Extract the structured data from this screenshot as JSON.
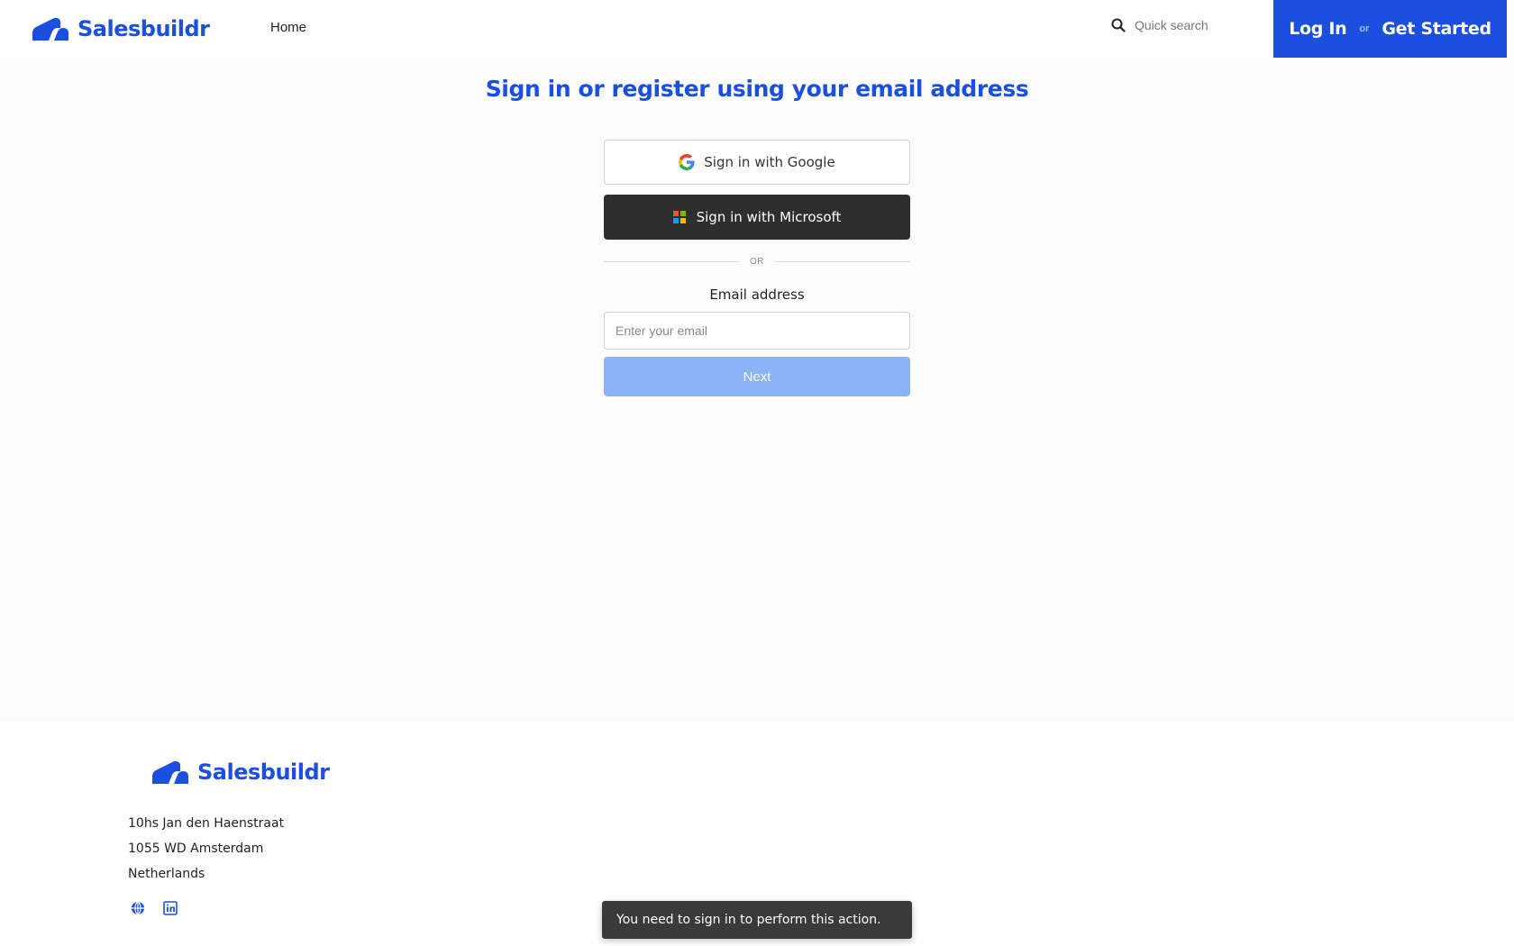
{
  "header": {
    "brand": "Salesbuildr",
    "nav_home": "Home",
    "search_placeholder": "Quick search",
    "login_label": "Log In",
    "or_label": "or",
    "get_started_label": "Get Started"
  },
  "main": {
    "title": "Sign in or register using your email address",
    "google_label": "Sign in with Google",
    "microsoft_label": "Sign in with Microsoft",
    "divider_label": "OR",
    "email_label": "Email address",
    "email_placeholder": "Enter your email",
    "email_value": "",
    "next_label": "Next"
  },
  "footer": {
    "brand": "Salesbuildr",
    "address_line1": "10hs Jan den Haenstraat",
    "address_line2": "1055 WD Amsterdam",
    "address_line3": "Netherlands",
    "icons": [
      "globe-icon",
      "linkedin-icon"
    ]
  },
  "toast": {
    "message": "You need to sign in to perform this action."
  },
  "colors": {
    "brand_blue": "#1a4fe0",
    "next_disabled": "#8bb3f6",
    "microsoft_button": "#2e2e2e",
    "toast_bg": "#3a3a3a"
  }
}
